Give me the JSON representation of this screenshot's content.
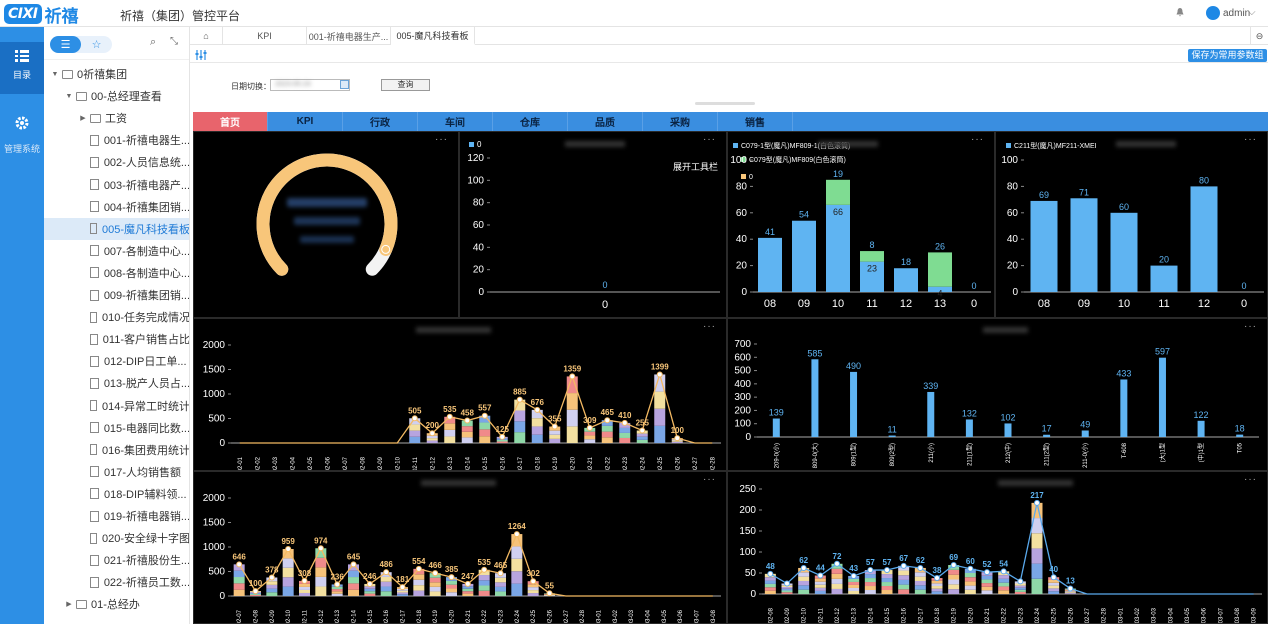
{
  "header": {
    "logo_en": "CIXI",
    "logo_cn": "祈禧",
    "title": "祈禧（集团）管控平台",
    "user": "admin"
  },
  "leftnav": {
    "items": [
      {
        "label": "目录"
      },
      {
        "label": "管理系统"
      }
    ]
  },
  "tree": {
    "items": [
      {
        "label": "0祈禧集团",
        "level": 0,
        "type": "folder",
        "open": true
      },
      {
        "label": "00-总经理查看",
        "level": 1,
        "type": "folder",
        "open": true
      },
      {
        "label": "工资",
        "level": 2,
        "type": "folder",
        "open": false
      },
      {
        "label": "001-祈禧电器生...",
        "level": 2,
        "type": "doc"
      },
      {
        "label": "002-人员信息统...",
        "level": 2,
        "type": "doc"
      },
      {
        "label": "003-祈禧电器产...",
        "level": 2,
        "type": "doc"
      },
      {
        "label": "004-祈禧集团销...",
        "level": 2,
        "type": "doc"
      },
      {
        "label": "005-魔凡科技看板",
        "level": 2,
        "type": "doc",
        "selected": true
      },
      {
        "label": "007-各制造中心...",
        "level": 2,
        "type": "doc"
      },
      {
        "label": "008-各制造中心...",
        "level": 2,
        "type": "doc"
      },
      {
        "label": "009-祈禧集团销...",
        "level": 2,
        "type": "doc"
      },
      {
        "label": "010-任务完成情况",
        "level": 2,
        "type": "doc"
      },
      {
        "label": "011-客户销售占比",
        "level": 2,
        "type": "doc"
      },
      {
        "label": "012-DIP日工单...",
        "level": 2,
        "type": "doc"
      },
      {
        "label": "013-脱产人员占...",
        "level": 2,
        "type": "doc"
      },
      {
        "label": "014-异常工时统计",
        "level": 2,
        "type": "doc"
      },
      {
        "label": "015-电器同比数...",
        "level": 2,
        "type": "doc"
      },
      {
        "label": "016-集团费用统计",
        "level": 2,
        "type": "doc"
      },
      {
        "label": "017-人均销售额",
        "level": 2,
        "type": "doc"
      },
      {
        "label": "018-DIP辅料领...",
        "level": 2,
        "type": "doc"
      },
      {
        "label": "019-祈禧电器销...",
        "level": 2,
        "type": "doc"
      },
      {
        "label": "020-安全绿十字图",
        "level": 2,
        "type": "doc"
      },
      {
        "label": "021-祈禧股份生...",
        "level": 2,
        "type": "doc"
      },
      {
        "label": "022-祈禧员工数...",
        "level": 2,
        "type": "doc"
      },
      {
        "label": "01-总经办",
        "level": 1,
        "type": "folder",
        "open": false
      }
    ]
  },
  "tabs": [
    {
      "label": "KPI"
    },
    {
      "label": "001-祈禧电器生产..."
    },
    {
      "label": "005-魔凡科技看板",
      "active": true
    }
  ],
  "filter": {
    "save_label": "保存为常用参数组合",
    "date_label": "日期切换：",
    "date_value": "2023-05-24",
    "query_label": "查询"
  },
  "categories": [
    {
      "label": "首页",
      "active": true
    },
    {
      "label": "KPI"
    },
    {
      "label": "行政"
    },
    {
      "label": "车间"
    },
    {
      "label": "仓库"
    },
    {
      "label": "品质"
    },
    {
      "label": "采购"
    },
    {
      "label": "销售"
    }
  ],
  "colors": {
    "bar_blue": "#5fb4f2",
    "bar_green": "#7fdc92",
    "gauge": "#f8c67a",
    "line_orange": "#f3b962",
    "line_blue": "#5aa9ec"
  },
  "chart_data": [
    {
      "type": "gauge",
      "title": "",
      "value_fraction": 0.92
    },
    {
      "type": "bar",
      "legend": [
        "0"
      ],
      "categories": [
        "0"
      ],
      "values": [
        0
      ],
      "ylim": [
        0,
        120
      ],
      "yticks": [
        0,
        20,
        40,
        60,
        80,
        100,
        120
      ],
      "annotation": "展开工具栏"
    },
    {
      "type": "bar",
      "stacked": true,
      "legend": [
        "C079-1型(魔凡)MF809-1(白色滚筒)",
        "C079型(魔凡)MF809(白色滚筒)",
        "0"
      ],
      "categories": [
        "08",
        "09",
        "10",
        "11",
        "12",
        "13",
        "0"
      ],
      "series": [
        {
          "name": "C079-1型(魔凡)MF809-1(白色滚筒)",
          "values": [
            41,
            54,
            66,
            23,
            18,
            4,
            0
          ]
        },
        {
          "name": "C079型(魔凡)MF809(白色滚筒)",
          "values": [
            0,
            0,
            19,
            8,
            0,
            26,
            0
          ]
        }
      ],
      "top_labels": [
        "41",
        "54",
        "19",
        "8",
        "18",
        "26",
        "0"
      ],
      "inner_labels": [
        "",
        "",
        "66",
        "23",
        "",
        "4",
        ""
      ],
      "ylim": [
        0,
        100
      ],
      "yticks": [
        0,
        20,
        40,
        60,
        80,
        100
      ]
    },
    {
      "type": "bar",
      "legend": [
        "C211型(魔凡)MF211-XMEI"
      ],
      "categories": [
        "08",
        "09",
        "10",
        "11",
        "12",
        "0"
      ],
      "values": [
        69,
        71,
        60,
        20,
        80,
        0
      ],
      "ylim": [
        0,
        100
      ],
      "yticks": [
        0,
        20,
        40,
        60,
        80,
        100
      ]
    },
    {
      "type": "bar+line",
      "stacked": true,
      "categories": [
        "02-01",
        "02-02",
        "02-03",
        "02-04",
        "02-05",
        "02-06",
        "02-07",
        "02-08",
        "02-09",
        "02-10",
        "02-11",
        "02-12",
        "02-13",
        "02-14",
        "02-15",
        "02-16",
        "02-17",
        "02-18",
        "02-19",
        "02-20",
        "02-21",
        "02-22",
        "02-23",
        "02-24",
        "02-25",
        "02-26",
        "02-27",
        "02-28"
      ],
      "totals": [
        0,
        0,
        0,
        0,
        0,
        0,
        0,
        0,
        0,
        0,
        505,
        200,
        535,
        458,
        557,
        125,
        885,
        676,
        336,
        1359,
        309,
        465,
        410,
        255,
        1399,
        100,
        0,
        0
      ],
      "labels": [
        "",
        "",
        "",
        "",
        "",
        "",
        "",
        "",
        "",
        "",
        "505",
        "200",
        "535",
        "458",
        "557",
        "125",
        "885",
        "676",
        "355",
        "1359",
        "309",
        "465",
        "410",
        "255",
        "1399",
        "100",
        "",
        ""
      ],
      "ylim": [
        0,
        2000
      ],
      "yticks": [
        0,
        500,
        1000,
        1500,
        2000
      ]
    },
    {
      "type": "bar",
      "title": "",
      "categories": [
        "209-0(小)",
        "809-0(大)",
        "809(1型)",
        "809(2型)",
        "211(小)",
        "211(1型)",
        "212(中)",
        "211(2型)",
        "211-0(小)",
        "T-608",
        "(大)1型",
        "(中)1型",
        "T05"
      ],
      "values": [
        139,
        585,
        490,
        11,
        339,
        132,
        102,
        17,
        49,
        433,
        597,
        122,
        18
      ],
      "ylim": [
        0,
        700
      ],
      "yticks": [
        0,
        100,
        200,
        300,
        400,
        500,
        600,
        700
      ]
    },
    {
      "type": "bar+line",
      "stacked": true,
      "categories": [
        "02-07",
        "02-08",
        "02-09",
        "02-10",
        "02-11",
        "02-12",
        "02-13",
        "02-14",
        "02-15",
        "02-16",
        "02-17",
        "02-18",
        "02-19",
        "02-20",
        "02-21",
        "02-22",
        "02-23",
        "02-24",
        "02-25",
        "02-26",
        "02-27",
        "02-28",
        "03-01",
        "03-02",
        "03-03",
        "03-04",
        "03-05",
        "03-06",
        "03-07",
        "03-08"
      ],
      "totals": [
        646,
        100,
        378,
        959,
        308,
        974,
        236,
        645,
        246,
        486,
        181,
        554,
        466,
        385,
        247,
        535,
        465,
        1264,
        302,
        55,
        0,
        0,
        0,
        0,
        0,
        0,
        0,
        0,
        0,
        0
      ],
      "labels": [
        "646",
        "100",
        "378",
        "959",
        "308",
        "974",
        "236",
        "645",
        "246",
        "486",
        "181",
        "554",
        "466",
        "385",
        "247",
        "535",
        "465",
        "1264",
        "302",
        "55",
        "",
        "",
        "",
        "",
        "",
        "",
        "",
        "",
        "",
        ""
      ],
      "ylim": [
        0,
        2000
      ],
      "yticks": [
        0,
        500,
        1000,
        1500,
        2000
      ]
    },
    {
      "type": "bar+line",
      "stacked": true,
      "title": "",
      "categories": [
        "02-08",
        "02-09",
        "02-10",
        "02-11",
        "02-12",
        "02-13",
        "02-14",
        "02-15",
        "02-16",
        "02-17",
        "02-18",
        "02-19",
        "02-20",
        "02-21",
        "02-22",
        "02-23",
        "02-24",
        "02-25",
        "02-26",
        "02-27",
        "02-28",
        "03-01",
        "03-02",
        "03-03",
        "03-04",
        "03-05",
        "03-06",
        "03-07",
        "03-08",
        "03-09"
      ],
      "totals": [
        48,
        25,
        62,
        44,
        72,
        43,
        57,
        57,
        67,
        62,
        38,
        69,
        60,
        52,
        54,
        30,
        217,
        40,
        13,
        0,
        0,
        0,
        0,
        0,
        0,
        0,
        0,
        0,
        0,
        0
      ],
      "labels": [
        "48",
        "",
        "62",
        "44",
        "72",
        "43",
        "57",
        "57",
        "67",
        "62",
        "38",
        "69",
        "60",
        "52",
        "54",
        "",
        "217",
        "40",
        "13",
        "",
        "",
        "",
        "",
        "",
        "",
        "",
        "",
        "",
        "",
        ""
      ],
      "ylim": [
        0,
        250
      ],
      "yticks": [
        0,
        50,
        100,
        150,
        200,
        250
      ]
    }
  ]
}
